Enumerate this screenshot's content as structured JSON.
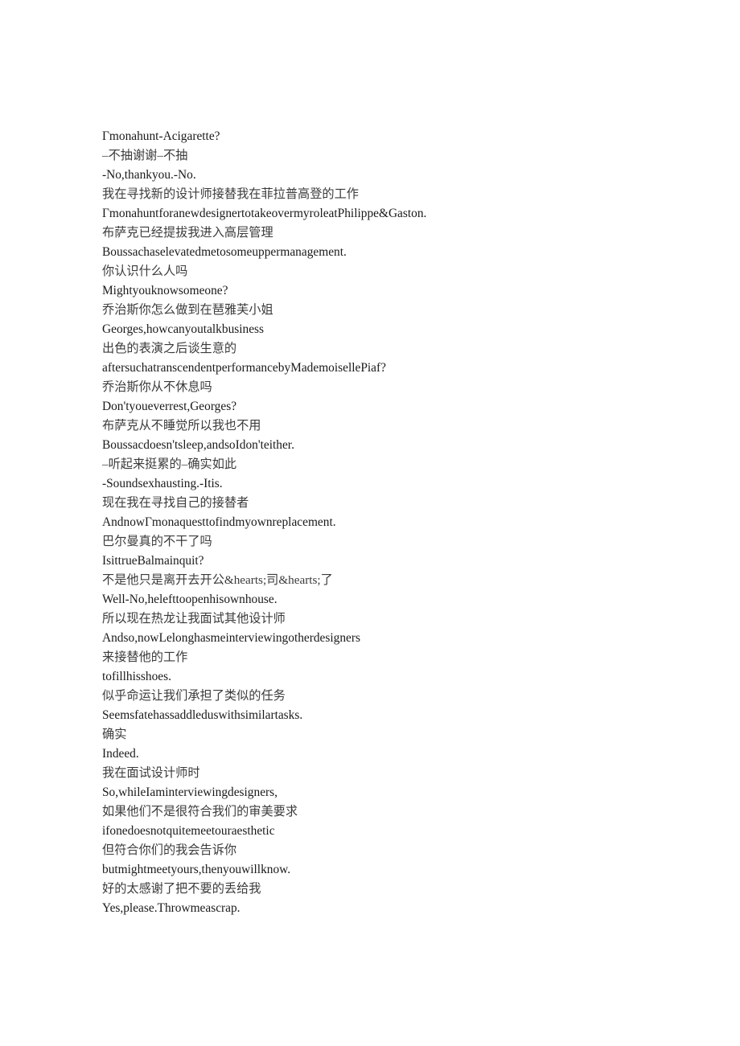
{
  "document": {
    "kind": "bilingual-subtitle-transcript",
    "background_color": "#ffffff",
    "text_color_en": "#1a1a1a",
    "text_color_zh": "#3b3b3b",
    "lines": [
      {
        "lang": "en",
        "text": "Γmonahunt-Acigarette?"
      },
      {
        "lang": "zh",
        "text": "–不抽谢谢–不抽"
      },
      {
        "lang": "en",
        "text": "-No,thankyou.-No."
      },
      {
        "lang": "zh",
        "text": "我在寻找新的设计师接替我在菲拉普高登的工作"
      },
      {
        "lang": "en",
        "text": "ΓmonahuntforanewdesignertotakeovermyroleatPhilippe&Gaston."
      },
      {
        "lang": "zh",
        "text": "布萨克已经提拔我进入高层管理"
      },
      {
        "lang": "en",
        "text": "Boussachaselevatedmetosomeuppermanagement."
      },
      {
        "lang": "zh",
        "text": "你认识什么人吗"
      },
      {
        "lang": "en",
        "text": "Mightyouknowsomeone?"
      },
      {
        "lang": "zh",
        "text": "乔治斯你怎么做到在琶雅芙小姐"
      },
      {
        "lang": "en",
        "text": "Georges,howcanyoutalkbusiness"
      },
      {
        "lang": "zh",
        "text": "出色的表演之后谈生意的"
      },
      {
        "lang": "en",
        "text": "aftersuchatranscendentperformancebyMademoisellePiaf?"
      },
      {
        "lang": "zh",
        "text": "乔治斯你从不休息吗"
      },
      {
        "lang": "en",
        "text": "Don'tyoueverrest,Georges?"
      },
      {
        "lang": "zh",
        "text": "布萨克从不睡觉所以我也不用"
      },
      {
        "lang": "en",
        "text": "Boussacdoesn'tsleep,andsoIdon'teither."
      },
      {
        "lang": "zh",
        "text": "–听起来挺累的–确实如此"
      },
      {
        "lang": "en",
        "text": "-Soundsexhausting.-Itis."
      },
      {
        "lang": "zh",
        "text": "现在我在寻找自己的接替者"
      },
      {
        "lang": "en",
        "text": "AndnowΓmonaquesttofindmyownreplacement."
      },
      {
        "lang": "zh",
        "text": "巴尔曼真的不干了吗"
      },
      {
        "lang": "en",
        "text": "IsittrueBalmainquit?"
      },
      {
        "lang": "zh",
        "text": "不是他只是离开去开公&hearts;司&hearts;了"
      },
      {
        "lang": "en",
        "text": "Well-No,helefttoopenhisownhouse."
      },
      {
        "lang": "zh",
        "text": "所以现在热龙让我面试其他设计师"
      },
      {
        "lang": "en",
        "text": "Andso,nowLelonghasmeinterviewingotherdesigners"
      },
      {
        "lang": "zh",
        "text": "来接替他的工作"
      },
      {
        "lang": "en",
        "text": "tofillhisshoes."
      },
      {
        "lang": "zh",
        "text": "似乎命运让我们承担了类似的任务"
      },
      {
        "lang": "en",
        "text": "Seemsfatehassaddleduswithsimilartasks."
      },
      {
        "lang": "zh",
        "text": "确实"
      },
      {
        "lang": "en",
        "text": "Indeed."
      },
      {
        "lang": "zh",
        "text": "我在面试设计师时"
      },
      {
        "lang": "en",
        "text": "So,whileIaminterviewingdesigners,"
      },
      {
        "lang": "zh",
        "text": "如果他们不是很符合我们的审美要求"
      },
      {
        "lang": "en",
        "text": "ifonedoesnotquitemeetouraesthetic"
      },
      {
        "lang": "zh",
        "text": "但符合你们的我会告诉你"
      },
      {
        "lang": "en",
        "text": "butmightmeetyours,thenyouwillknow."
      },
      {
        "lang": "zh",
        "text": "好的太感谢了把不要的丢给我"
      },
      {
        "lang": "en",
        "text": "Yes,please.Throwmeascrap."
      }
    ]
  }
}
